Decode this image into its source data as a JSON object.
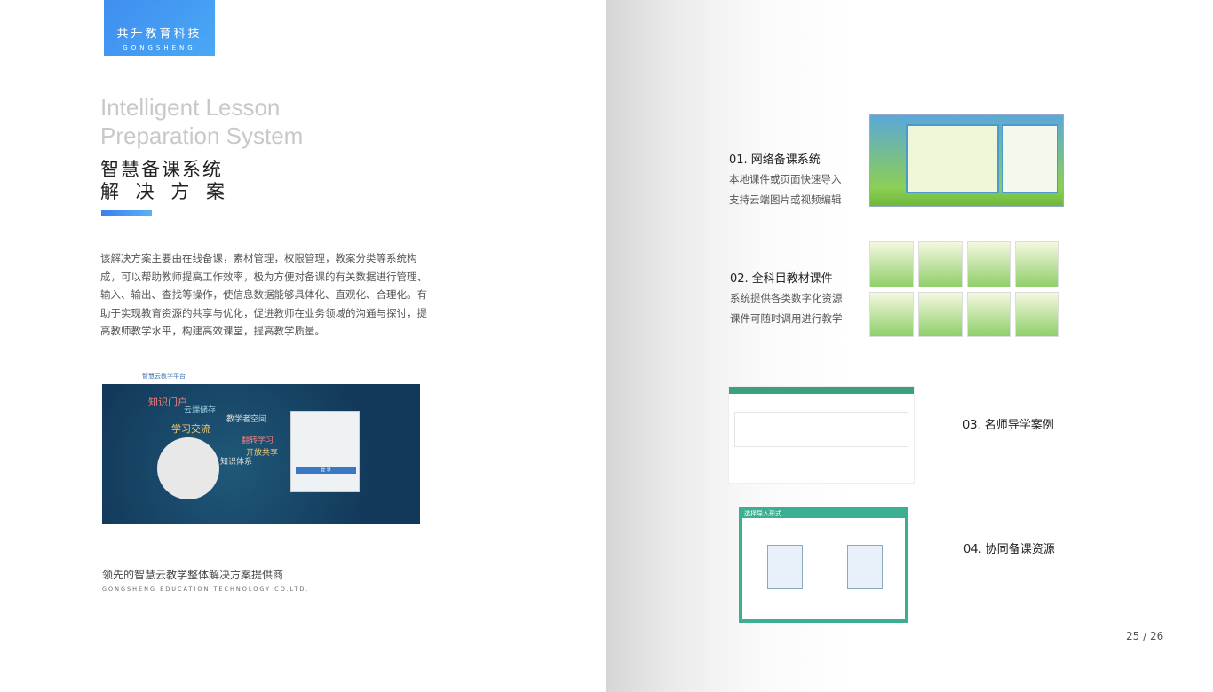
{
  "brand": {
    "name_cn": "共升教育科技",
    "name_en": "GONGSHENG"
  },
  "title": {
    "en_line1": "Intelligent Lesson",
    "en_line2": "Preparation System",
    "cn_line1": "智慧备课系统",
    "cn_line2": "解 决 方 案"
  },
  "description": "该解决方案主要由在线备课，素材管理，权限管理，教案分类等系统构成，可以帮助教师提高工作效率，极为方便对备课的有关数据进行管理、输入、输出、查找等操作，使信息数据能够具体化、直观化、合理化。有助于实现教育资源的共享与优化，促进教师在业务领域的沟通与探讨，提高教师教学水平，构建高效课堂，提高教学质量。",
  "platform_shot": {
    "header": "智慧云教学平台",
    "labels": [
      "知识门户",
      "云端储存",
      "学习交流",
      "教学者空间",
      "翻转学习",
      "开放共享",
      "知识体系"
    ],
    "login_button": "登 录"
  },
  "tagline": {
    "cn": "领先的智慧云教学整体解决方案提供商",
    "en": "GONGSHENG EDUCATION TECHNOLOGY CO.LTD."
  },
  "features": [
    {
      "title": "01.  网络备课系统",
      "lines": [
        "本地课件或页面快速导入",
        "支持云端图片或视频编辑"
      ]
    },
    {
      "title": "02.  全科目教材课件",
      "lines": [
        "系统提供各类数字化资源",
        "课件可随时调用进行教学"
      ]
    },
    {
      "title": "03.  名师导学案例"
    },
    {
      "title": "04.  协同备课资源"
    }
  ],
  "dialog_shot": {
    "title": "选择导入形式"
  },
  "page_number": "25 / 26"
}
